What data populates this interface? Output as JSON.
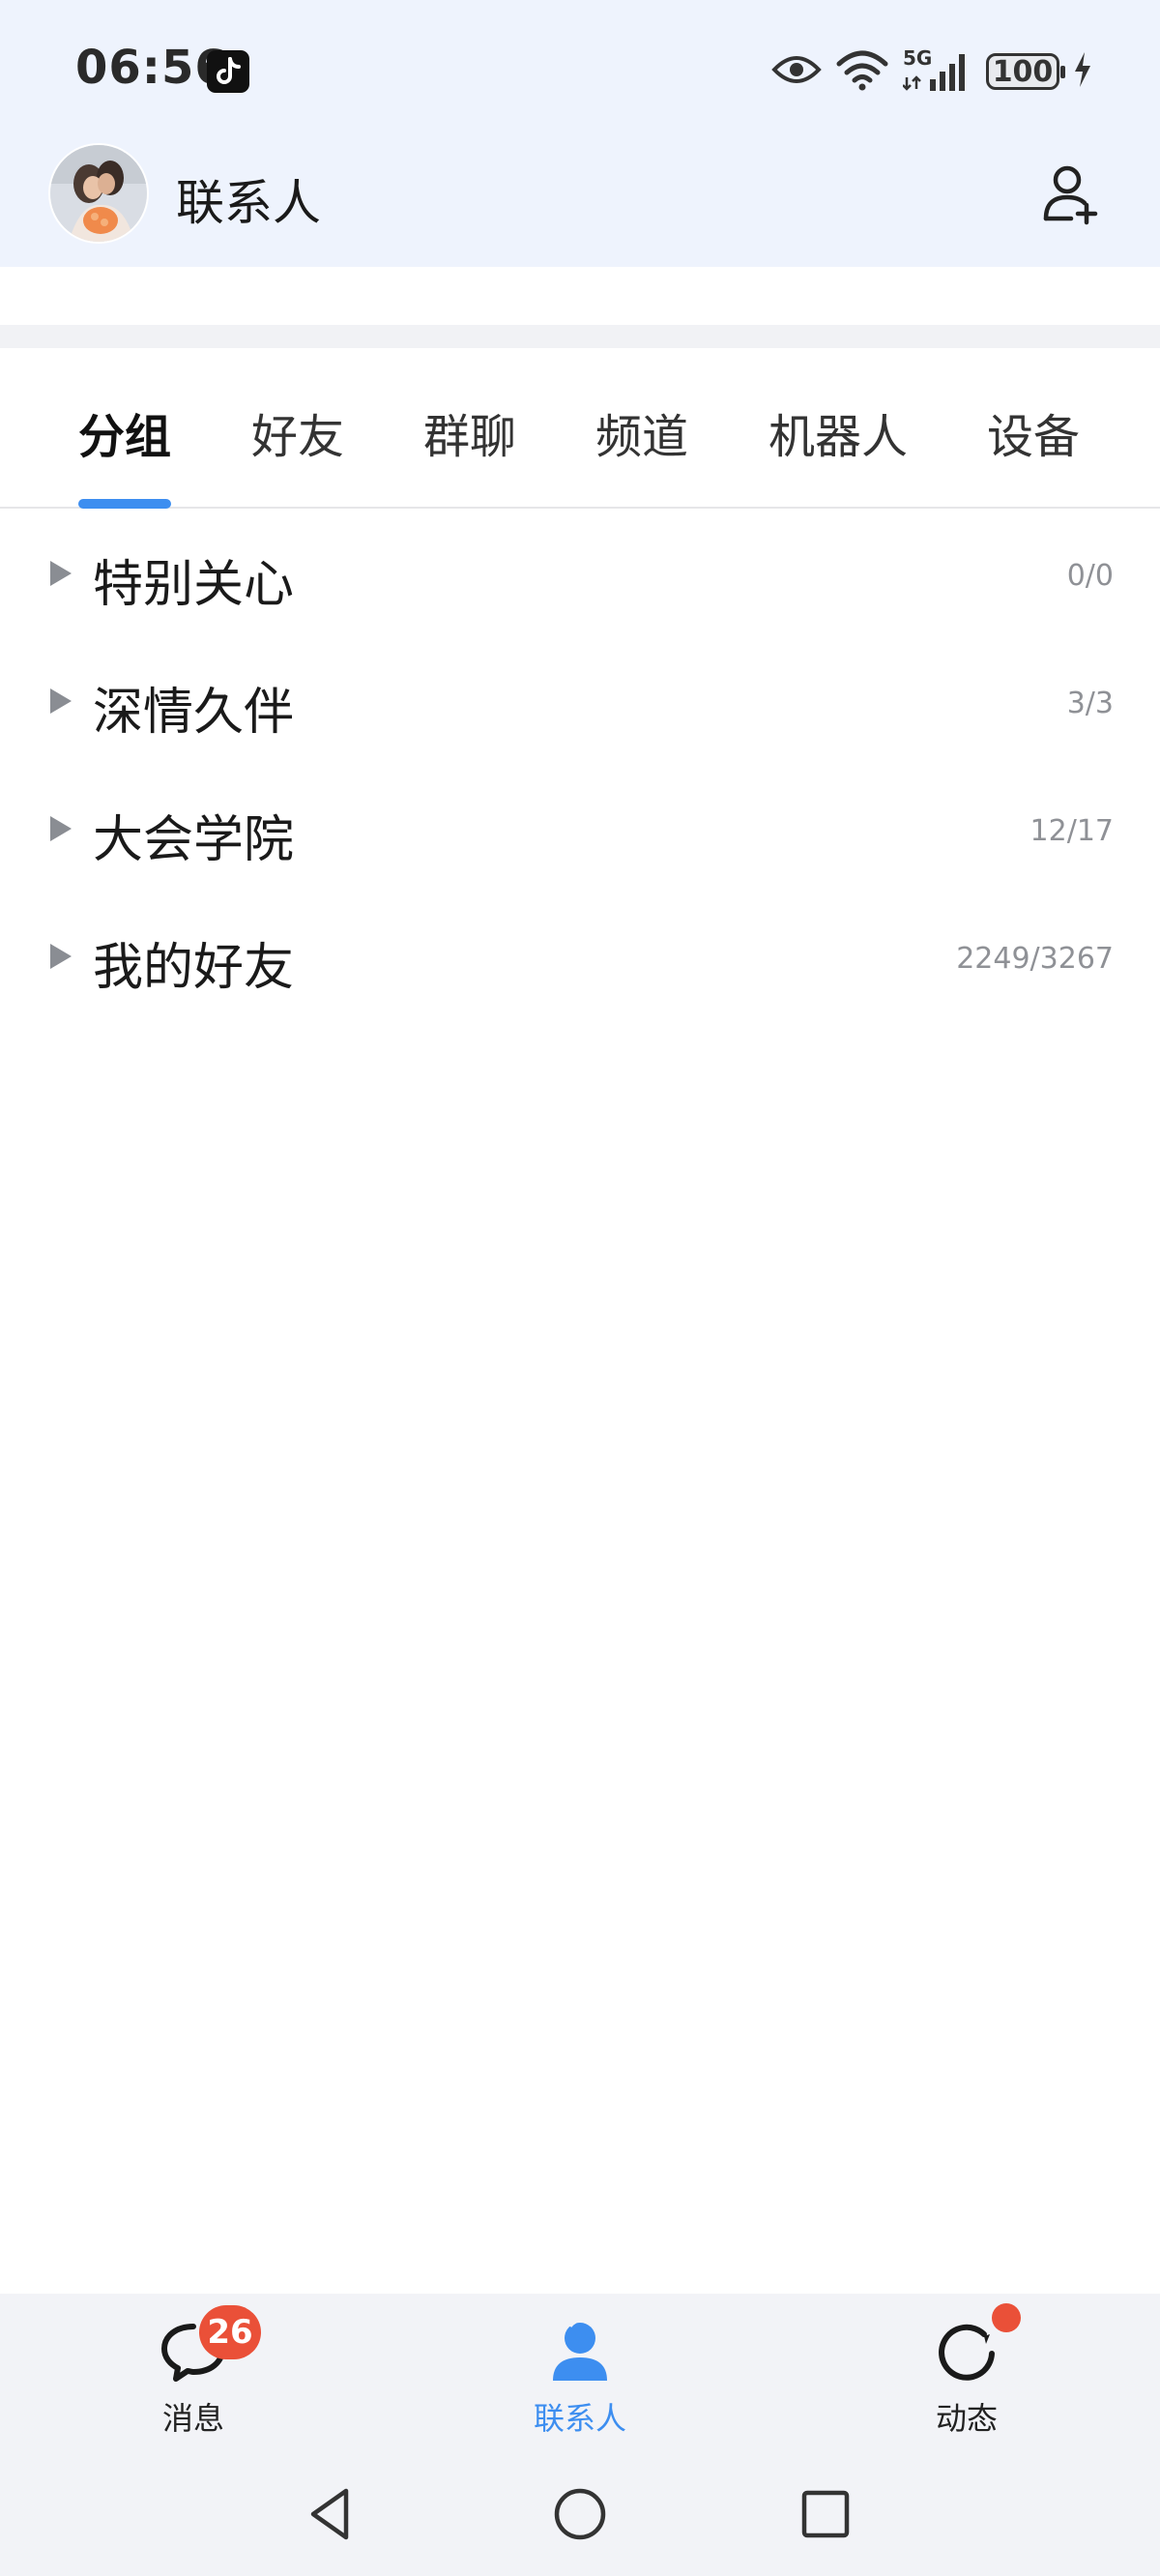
{
  "status_bar": {
    "time": "06:56",
    "network": "5G",
    "battery": "100"
  },
  "header": {
    "title": "联系人"
  },
  "tabs": [
    {
      "label": "分组",
      "active": true
    },
    {
      "label": "好友",
      "active": false
    },
    {
      "label": "群聊",
      "active": false
    },
    {
      "label": "频道",
      "active": false
    },
    {
      "label": "机器人",
      "active": false
    },
    {
      "label": "设备",
      "active": false
    }
  ],
  "groups": [
    {
      "name": "特别关心",
      "count": "0/0"
    },
    {
      "name": "深情久伴",
      "count": "3/3"
    },
    {
      "name": "大会学院",
      "count": "12/17"
    },
    {
      "name": "我的好友",
      "count": "2249/3267"
    }
  ],
  "bottom_nav": {
    "messages": {
      "label": "消息",
      "badge": "26"
    },
    "contacts": {
      "label": "联系人"
    },
    "moments": {
      "label": "动态"
    }
  },
  "colors": {
    "accent": "#3d8ef0",
    "badge": "#ea5038",
    "header_bg": "#eef3fd"
  }
}
